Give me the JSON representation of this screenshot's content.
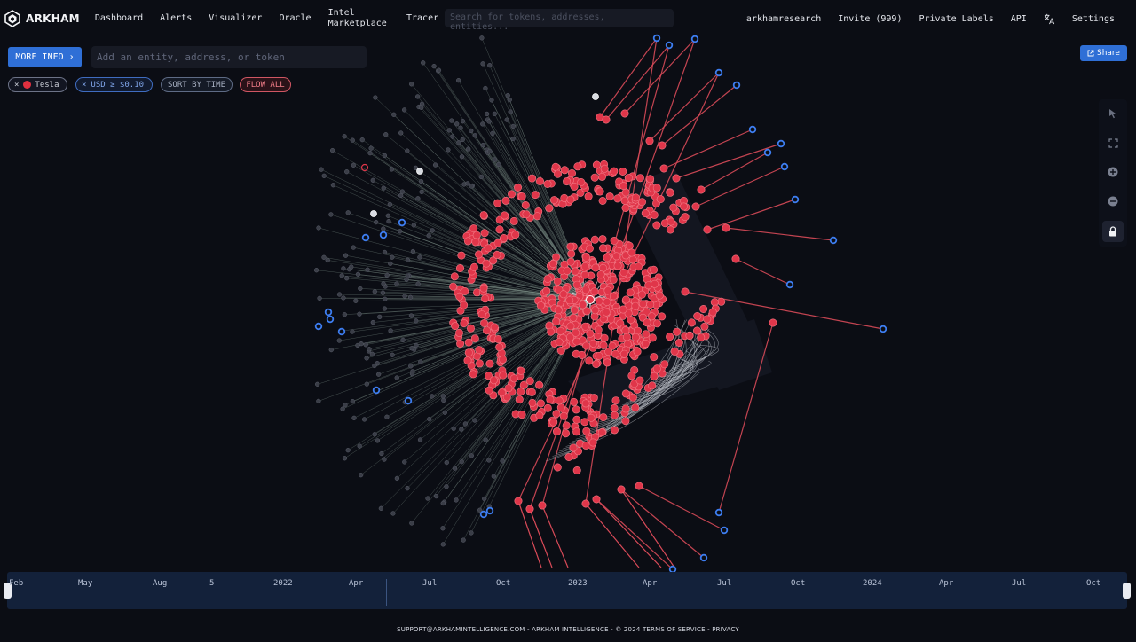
{
  "nav": {
    "logo_text": "ARKHAM",
    "items": [
      "Dashboard",
      "Alerts",
      "Visualizer",
      "Oracle",
      "Intel Marketplace"
    ],
    "tracer": "Tracer",
    "search_placeholder": "Search for tokens, addresses, entities...",
    "right_items": [
      "arkhamresearch",
      "Invite (999)",
      "Private Labels",
      "API"
    ],
    "settings": "Settings"
  },
  "toolbar": {
    "more_info": "MORE INFO",
    "entity_placeholder": "Add an entity, address, or token",
    "share": "Share"
  },
  "filters": {
    "entity": "Tesla",
    "min_usd": "USD ≥ $0.10",
    "sort": "SORT BY TIME",
    "flow": "FLOW ALL"
  },
  "graph": {
    "center_entity": "Tesla",
    "colors": {
      "entity_node": "#e0364a",
      "address_node": "#3a3d47",
      "labeled_node": "#3d7df0",
      "edge_out": "#d84a58",
      "edge_in": "#8fa59a"
    }
  },
  "timeline": {
    "labels": [
      "Feb",
      "May",
      "Aug",
      "5",
      "2022",
      "Apr",
      "Jul",
      "Oct",
      "2023",
      "Apr",
      "Jul",
      "Oct",
      "2024",
      "Apr",
      "Jul",
      "Oct"
    ]
  },
  "footer": "SUPPORT@ARKHAMINTELLIGENCE.COM - ARKHAM INTELLIGENCE - © 2024  TERMS OF SERVICE - PRIVACY"
}
